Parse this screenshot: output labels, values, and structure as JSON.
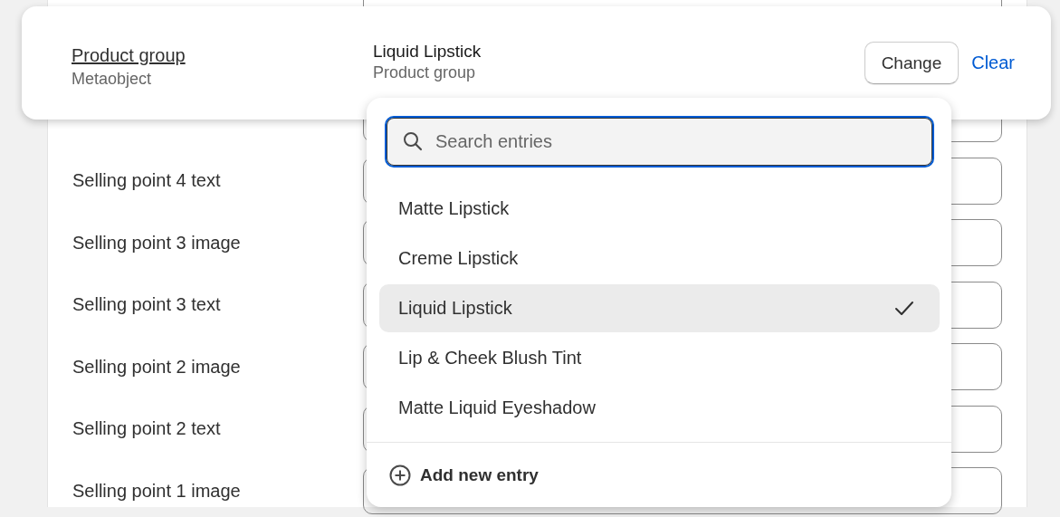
{
  "form_rows": [
    {
      "label": "Selling point 4 text"
    },
    {
      "label": "Selling point 3 image"
    },
    {
      "label": "Selling point 3 text"
    },
    {
      "label": "Selling point 2 image"
    },
    {
      "label": "Selling point 2 text"
    },
    {
      "label": "Selling point 1 image"
    }
  ],
  "picker_card": {
    "field_label": "Product group",
    "field_type": "Metaobject",
    "value_title": "Liquid Lipstick",
    "value_subtitle": "Product group",
    "buttons": [
      {
        "label": "Change",
        "kind": "secondary"
      },
      {
        "label": "Clear",
        "kind": "link"
      }
    ]
  },
  "dropdown": {
    "search": {
      "placeholder": "Search entries"
    },
    "entries": [
      {
        "label": "Matte Lipstick",
        "selected": false
      },
      {
        "label": "Creme Lipstick",
        "selected": false
      },
      {
        "label": "Liquid Lipstick",
        "selected": true
      },
      {
        "label": "Lip & Cheek Blush Tint",
        "selected": false
      },
      {
        "label": "Matte Liquid Eyeshadow",
        "selected": false
      }
    ],
    "add_action": "Add new entry"
  }
}
